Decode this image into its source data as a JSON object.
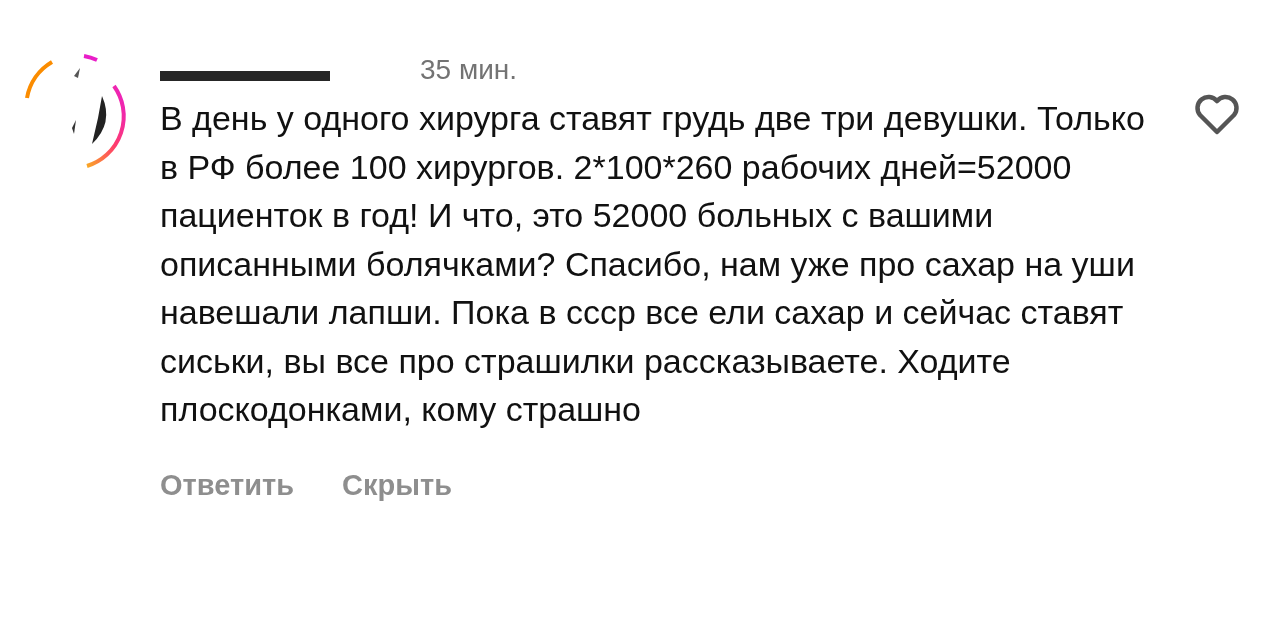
{
  "comment": {
    "time": "35 мин.",
    "text": "В день у одного хирурга ставят грудь две три девушки. Только в РФ более 100 хирургов. 2*100*260 рабочих дней=52000 пациенток в год! И что, это 52000 больных с вашими описанными болячками? Спасибо, нам уже про сахар на уши навешали лапши. Пока в ссср все ели сахар и сейчас ставят сиськи, вы все про страшилки рассказываете. Ходите плоскодонками, кому страшно",
    "liked": false,
    "actions": [
      "Ответить",
      "Скрыть"
    ]
  }
}
